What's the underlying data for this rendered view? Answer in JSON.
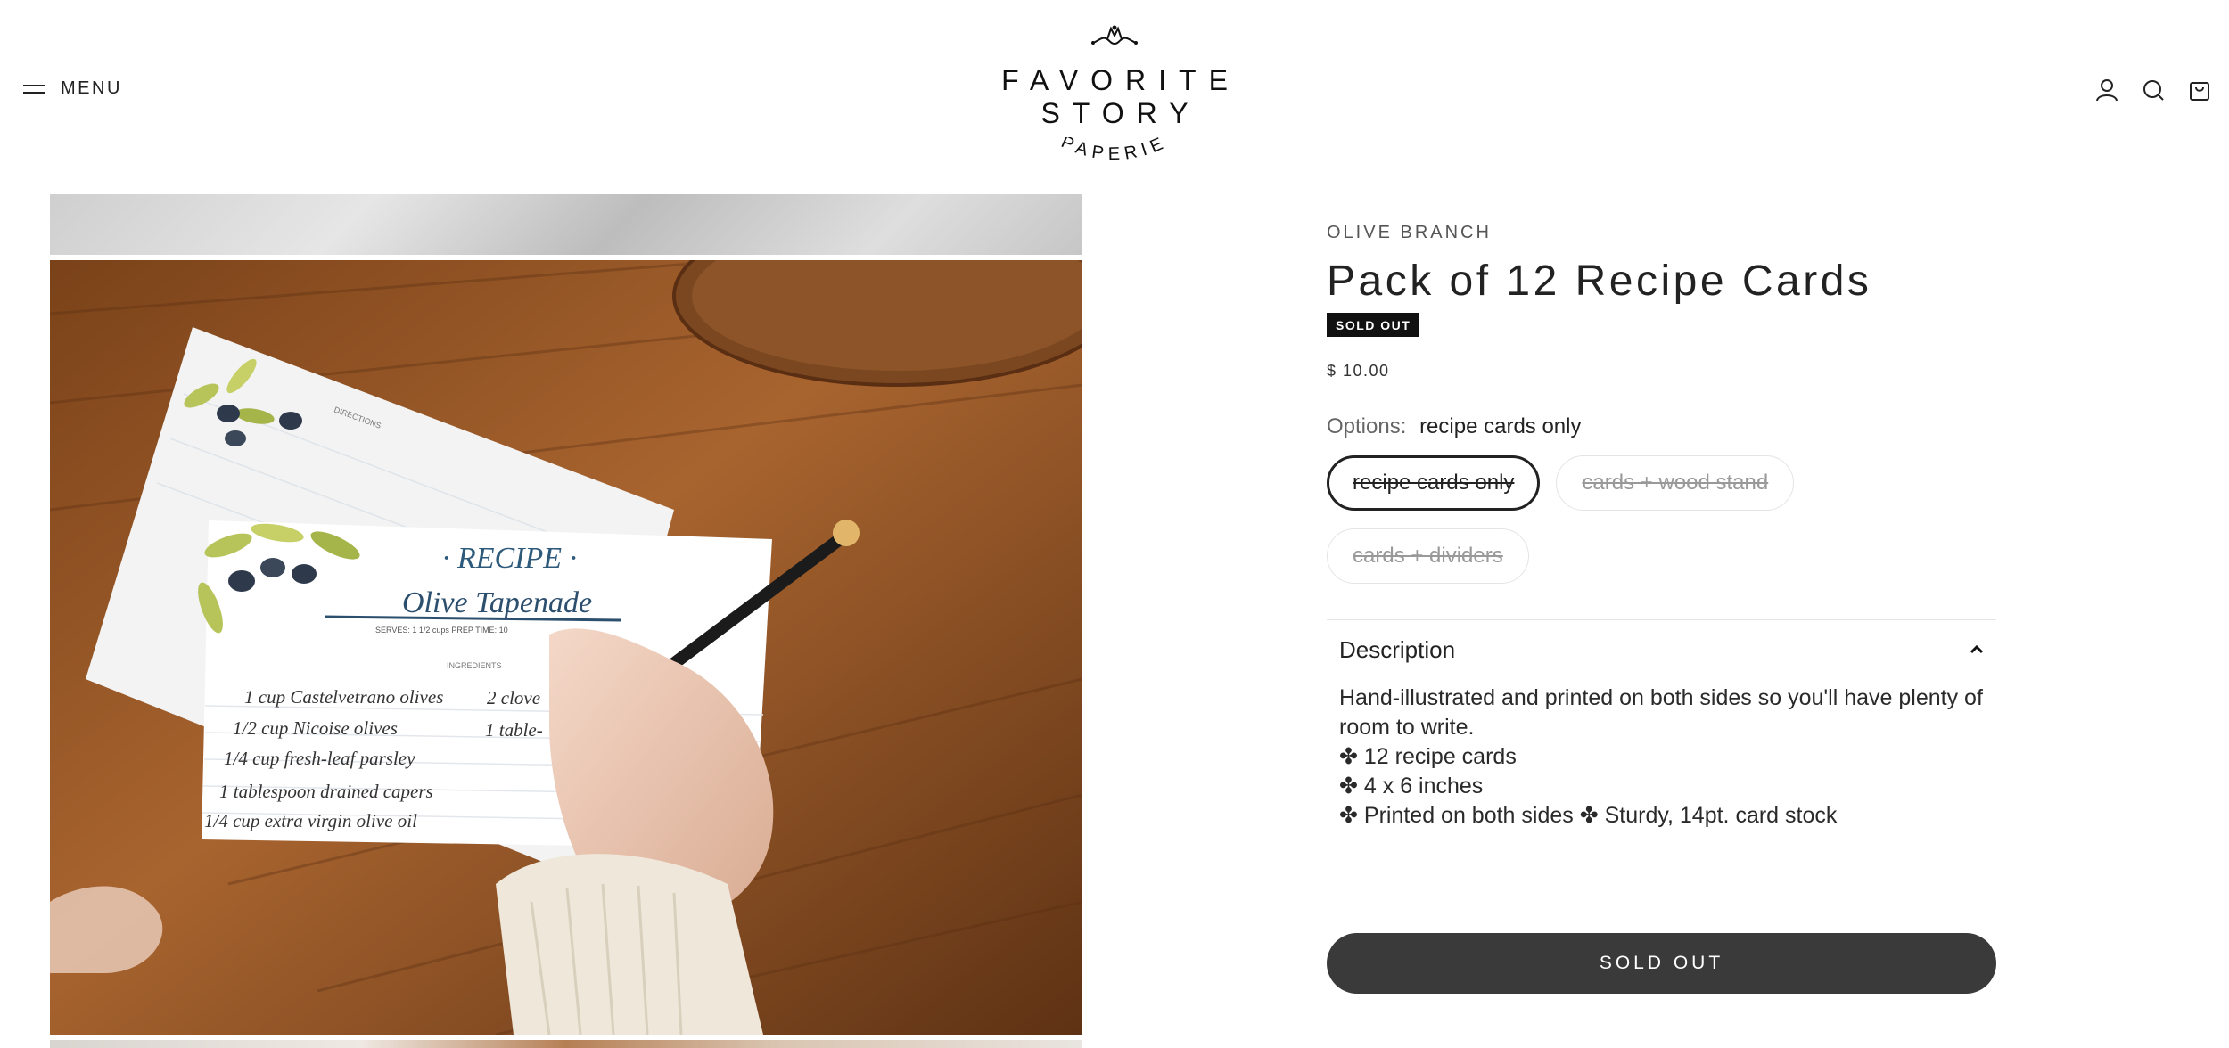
{
  "header": {
    "menu_label": "MENU",
    "logo_title": "FAVORITE STORY",
    "logo_subtitle": "PAPERIE",
    "icons": [
      "account-icon",
      "search-icon",
      "cart-icon"
    ]
  },
  "product": {
    "vendor": "OLIVE BRANCH",
    "title": "Pack of 12 Recipe Cards",
    "badge": "SOLD OUT",
    "price": "$ 10.00",
    "options_label": "Options:",
    "options_selected": "recipe cards only",
    "options": [
      {
        "label": "recipe cards only",
        "selected": true
      },
      {
        "label": "cards + wood stand",
        "selected": false
      },
      {
        "label": "cards + dividers",
        "selected": false
      }
    ],
    "description_title": "Description",
    "description_lines": [
      "Hand-illustrated and printed on both sides so you'll have plenty of room to write.",
      "✤ 12 recipe cards",
      "✤ 4 x 6 inches",
      "✤ Printed on both sides ✤ Sturdy, 14pt. card stock"
    ],
    "button_label": "SOLD OUT"
  },
  "photo": {
    "card_heading": "· RECIPE ·",
    "card_recipe_name": "Olive Tapenade",
    "card_serves": "SERVES: 1 1/2 cups   PREP TIME: 10",
    "card_directions": "DIRECTIONS",
    "card_ingredients": "INGREDIENTS",
    "card_lines": [
      "1 cup Castelvetrano olives",
      "1/2 cup Nicoise olives",
      "1/4 cup fresh-leaf parsley",
      "1 tablespoon drained capers",
      "1/4 cup extra virgin olive oil"
    ],
    "card_lines_right": [
      "2 clove",
      "1 table-"
    ]
  },
  "colors": {
    "accent": "#222222",
    "button_bg": "#3a3a3a",
    "badge_bg": "#111111",
    "wood": "#9a5a2a"
  }
}
